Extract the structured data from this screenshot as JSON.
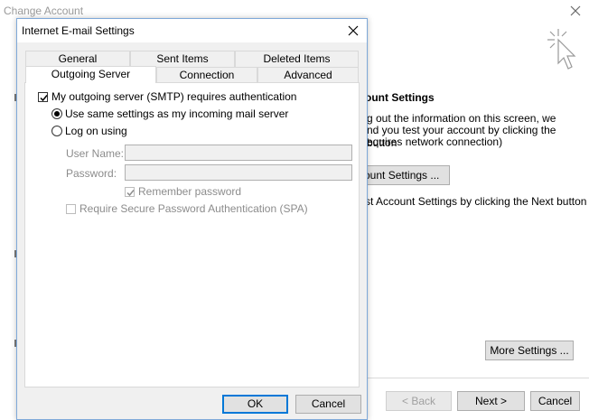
{
  "background_window": {
    "title": "Change Account",
    "heading": "ount Settings",
    "lines": [
      "g out the information on this screen, we",
      "nd you test your account by clicking the button",
      "equires network connection)"
    ],
    "test_button_label": "ount Settings ...",
    "next_hint": "st Account Settings by clicking the Next button",
    "more_settings_label": "More Settings ...",
    "back_label": "< Back",
    "next_label": "Next >",
    "cancel_label": "Cancel"
  },
  "dialog": {
    "title": "Internet E-mail Settings",
    "tabs": {
      "general": "General",
      "sent_items": "Sent Items",
      "deleted_items": "Deleted Items",
      "outgoing_server": "Outgoing Server",
      "connection": "Connection",
      "advanced": "Advanced"
    },
    "active_tab": "Outgoing Server",
    "smtp_auth_label": "My outgoing server (SMTP) requires authentication",
    "smtp_auth_checked": true,
    "use_same_label": "Use same settings as my incoming mail server",
    "logon_using_label": "Log on using",
    "selected_option": "Use same settings as my incoming mail server",
    "username_label": "User Name:",
    "username_value": "",
    "password_label": "Password:",
    "password_value": "",
    "remember_label": "Remember password",
    "remember_checked": true,
    "spa_label": "Require Secure Password Authentication (SPA)",
    "spa_checked": false,
    "ok_label": "OK",
    "cancel_label": "Cancel"
  },
  "icons": {
    "close": "close-icon",
    "wizard": "wizard-cursor-icon",
    "check": "checkmark-icon"
  },
  "colors": {
    "ok_focus_border": "#0078d7",
    "dialog_border": "#7fa9d9"
  }
}
